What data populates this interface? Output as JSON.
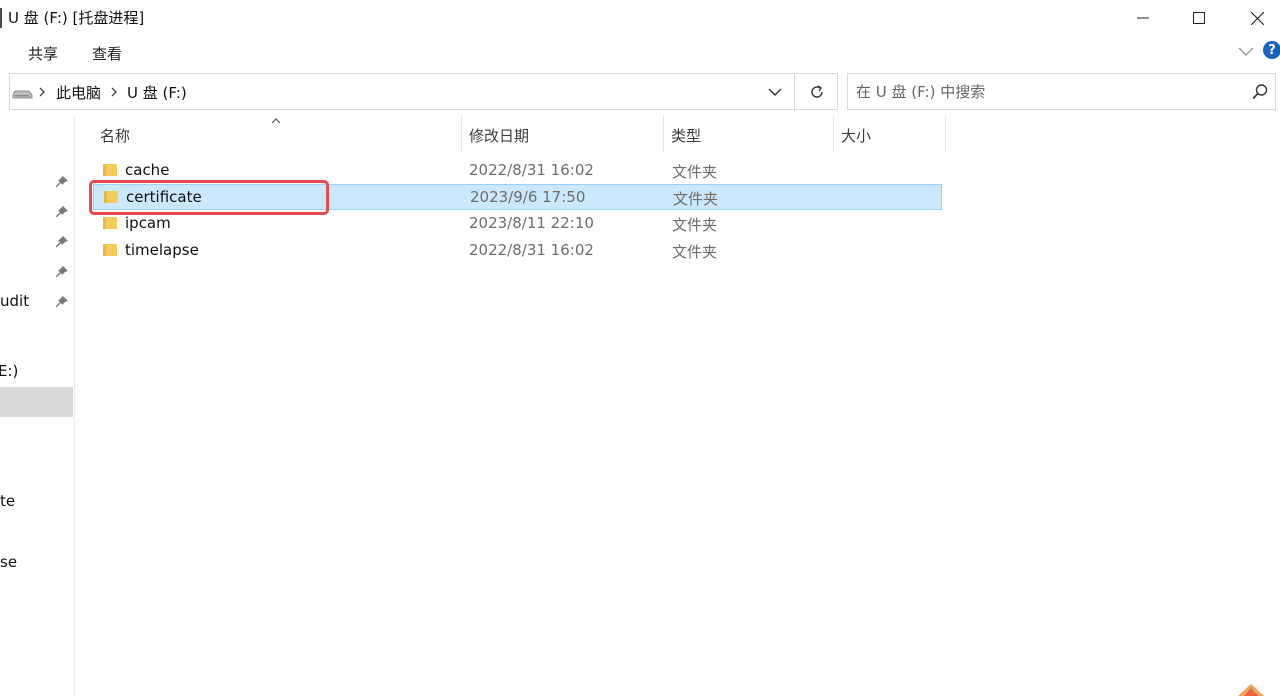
{
  "window": {
    "title": "U 盘 (F:) [托盘进程]"
  },
  "ribbon": {
    "tabs": [
      {
        "label": "共享"
      },
      {
        "label": "查看"
      }
    ],
    "help_label": "?"
  },
  "address": {
    "crumbs": [
      {
        "label": "此电脑"
      },
      {
        "label": "U 盘 (F:)"
      }
    ]
  },
  "search": {
    "placeholder": "在 U 盘 (F:) 中搜索"
  },
  "nav": {
    "items": [
      {
        "label": "udit"
      },
      {
        "label": "E:)"
      },
      {
        "label": "te"
      },
      {
        "label": "se"
      }
    ]
  },
  "list": {
    "columns": [
      {
        "label": "名称"
      },
      {
        "label": "修改日期"
      },
      {
        "label": "类型"
      },
      {
        "label": "大小"
      }
    ],
    "rows": [
      {
        "name": "cache",
        "date": "2022/8/31 16:02",
        "type": "文件夹",
        "selected": false
      },
      {
        "name": "certificate",
        "date": "2023/9/6 17:50",
        "type": "文件夹",
        "selected": true
      },
      {
        "name": "ipcam",
        "date": "2023/8/11 22:10",
        "type": "文件夹",
        "selected": false
      },
      {
        "name": "timelapse",
        "date": "2022/8/31 16:02",
        "type": "文件夹",
        "selected": false
      }
    ]
  },
  "colors": {
    "selection_fill": "#cce8ff",
    "selection_border": "#99d1ff",
    "highlight_annotation": "#e84a4f",
    "folder_yellow": "#f2c94c",
    "help_blue": "#1565c0"
  },
  "icons": {
    "drive": "usb-drive-icon",
    "folder": "folder-icon",
    "pin": "pin-icon",
    "refresh": "refresh-icon",
    "search": "search-icon"
  }
}
